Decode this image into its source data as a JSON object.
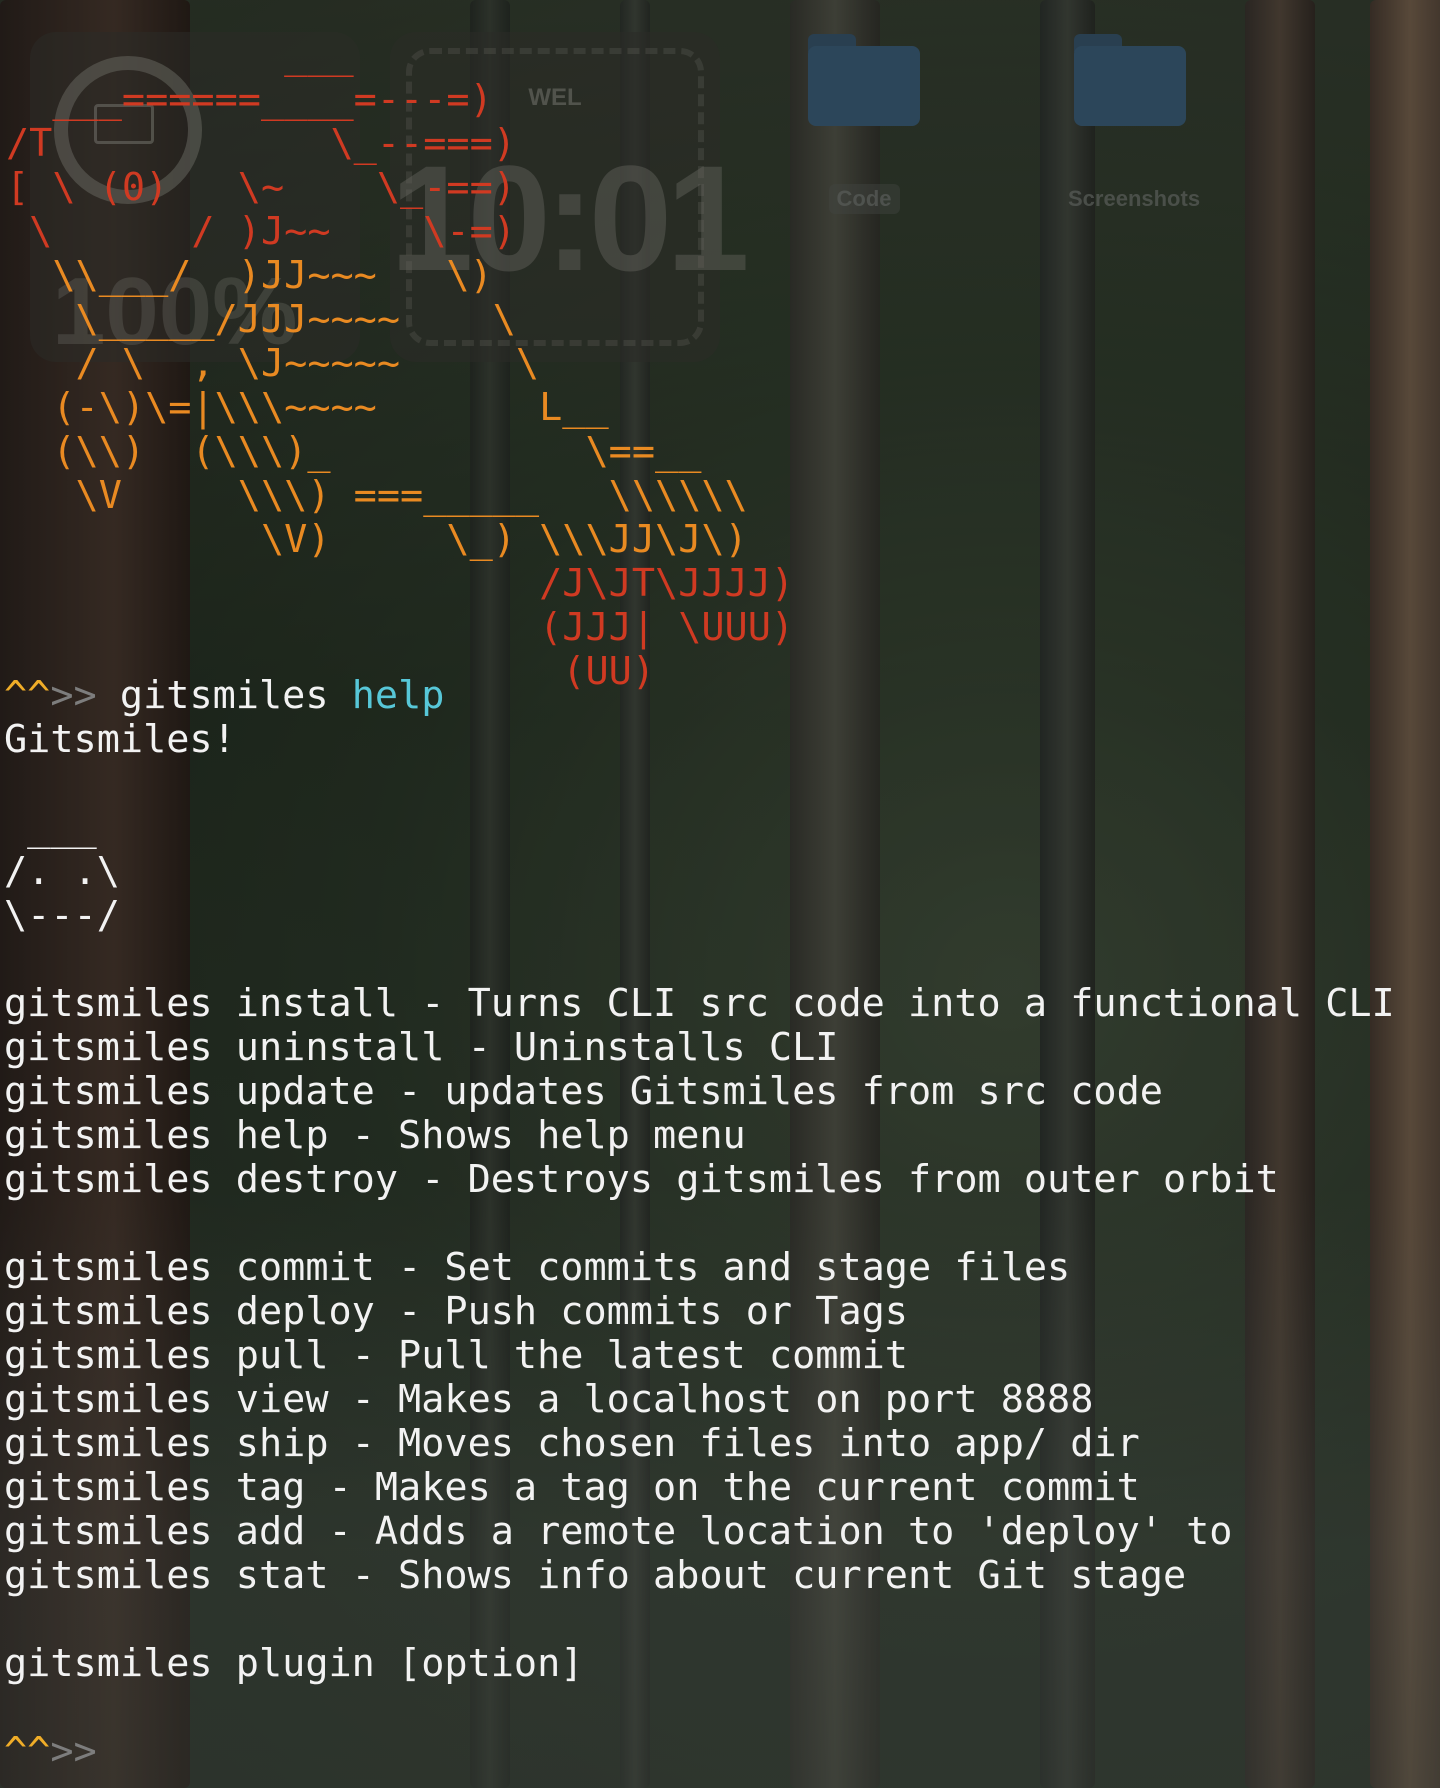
{
  "desktop": {
    "battery_widget": {
      "percentage": "100%"
    },
    "clock_widget": {
      "day": "WEL",
      "time": "10:01"
    },
    "folders": [
      {
        "label": "Code",
        "icon": "folder-icon"
      },
      {
        "label": "Screenshots",
        "icon": "folder-icon"
      }
    ]
  },
  "ascii_art": [
    "            ___",
    "  ___======____=---=)",
    "/T            \\_--===)",
    "[ \\ (0)   \\~    \\_-==)",
    " \\      / )J~~    \\-=)",
    "  \\\\___/  )JJ~~~   \\)",
    "   \\_____/JJJ~~~~    \\",
    "   / \\  , \\J~~~~~     \\",
    "  (-\\)\\=|\\\\\\~~~~       L__",
    "  (\\\\)  (\\\\\\)_           \\==__",
    "   \\V     \\\\\\) ===_____   \\\\\\\\\\\\",
    "           \\V)     \\_) \\\\\\JJ\\J\\)",
    "                       /J\\JT\\JJJJ)",
    "                       (JJJ| \\UUU)",
    "                        (UU)"
  ],
  "session": {
    "prompt_caret": "^^",
    "prompt_arrow": ">>",
    "command": "gitsmiles",
    "argument": "help",
    "banner": "Gitsmiles!",
    "face": [
      " ___",
      "/. .\\",
      "\\---/"
    ],
    "help_group_1": [
      "gitsmiles install - Turns CLI src code into a functional CLI",
      "gitsmiles uninstall - Uninstalls CLI",
      "gitsmiles update - updates Gitsmiles from src code",
      "gitsmiles help - Shows help menu",
      "gitsmiles destroy - Destroys gitsmiles from outer orbit"
    ],
    "help_group_2": [
      "gitsmiles commit - Set commits and stage files",
      "gitsmiles deploy - Push commits or Tags",
      "gitsmiles pull - Pull the latest commit",
      "gitsmiles view - Makes a localhost on port 8888",
      "gitsmiles ship - Moves chosen files into app/ dir",
      "gitsmiles tag - Makes a tag on the current commit",
      "gitsmiles add - Adds a remote location to 'deploy' to",
      "gitsmiles stat - Shows info about current Git stage"
    ],
    "help_group_3": [
      "gitsmiles plugin [option]"
    ]
  },
  "colors": {
    "ascii_red": "#d03a22",
    "ascii_orange": "#e98a22",
    "prompt_caret": "#f0ad28",
    "prompt_arrow": "#7d7d7d",
    "argument": "#57c7d8",
    "text": "#f2f2f2"
  }
}
